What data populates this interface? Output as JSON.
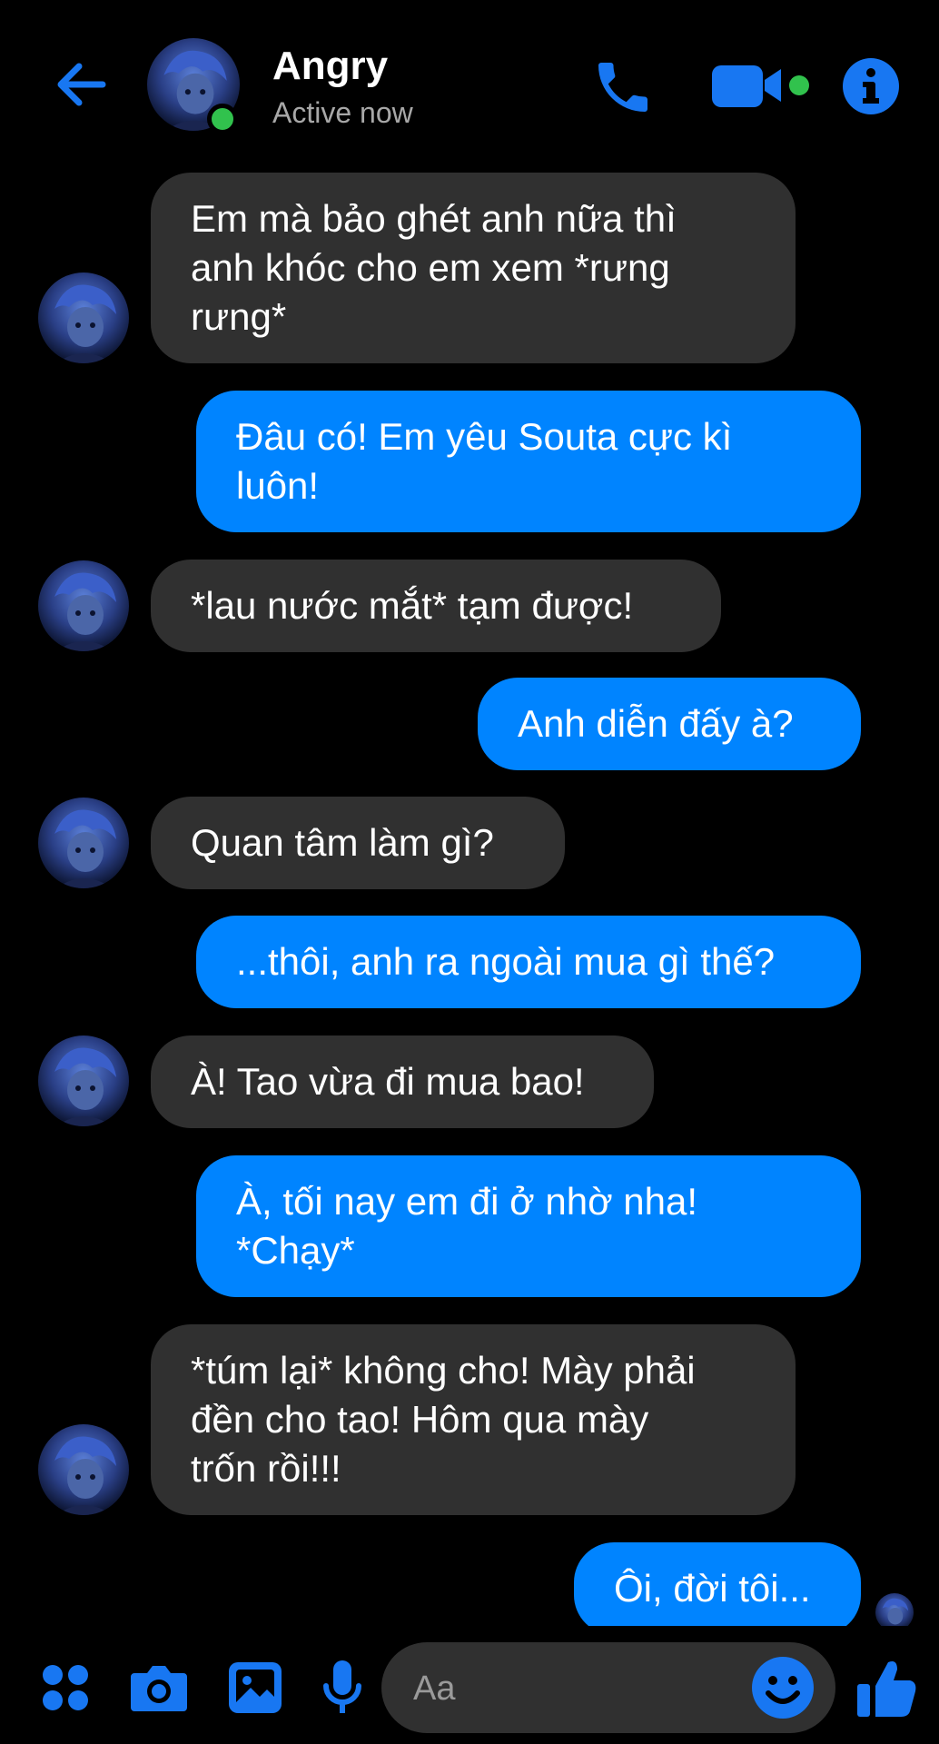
{
  "header": {
    "title": "Angry",
    "status": "Active now",
    "icons": [
      "back-arrow-icon",
      "phone-icon",
      "video-camera-icon",
      "info-icon"
    ]
  },
  "messages": [
    {
      "from": "them",
      "lines": [
        "Em mà bảo ghét anh nữa thì",
        "anh khóc cho em xem *rưng",
        "rưng*"
      ]
    },
    {
      "from": "me",
      "lines": [
        "Đâu có! Em yêu Souta cực kì",
        "luôn!"
      ]
    },
    {
      "from": "them",
      "lines": [
        "*lau nước mắt* tạm được!"
      ]
    },
    {
      "from": "me",
      "lines": [
        "Anh diễn đấy à?"
      ]
    },
    {
      "from": "them",
      "lines": [
        "Quan tâm làm gì?"
      ]
    },
    {
      "from": "me",
      "lines": [
        "...thôi, anh ra ngoài mua gì thế?"
      ]
    },
    {
      "from": "them",
      "lines": [
        "À! Tao vừa đi mua bao!"
      ]
    },
    {
      "from": "me",
      "lines": [
        "À, tối nay em đi ở nhờ nha!",
        "*Chạy*"
      ]
    },
    {
      "from": "them",
      "lines": [
        "*túm lại* không cho! Mày phải",
        "đền cho tao! Hôm qua mày",
        "trốn rồi!!!"
      ]
    },
    {
      "from": "me",
      "lines": [
        "Ôi, đời tôi..."
      ]
    }
  ],
  "composer": {
    "placeholder": "Aa",
    "icons": [
      "apps-icon",
      "camera-icon",
      "gallery-icon",
      "microphone-icon",
      "emoji-icon",
      "thumbs-up-icon"
    ]
  },
  "colors": {
    "accent": "#0084ff",
    "incoming": "#303030",
    "online": "#31c24d",
    "background": "#000000"
  }
}
